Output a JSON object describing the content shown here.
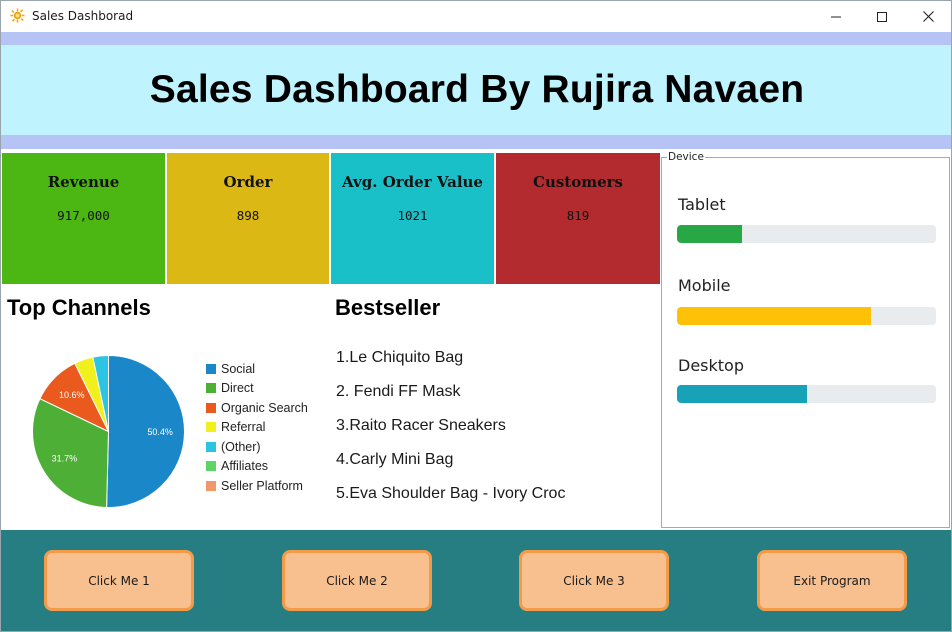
{
  "window": {
    "title": "Sales Dashborad"
  },
  "header": {
    "title": "Sales Dashboard By Rujira Navaen"
  },
  "kpis": [
    {
      "label": "Revenue",
      "value": "917,000",
      "color": "#4cb612"
    },
    {
      "label": "Order",
      "value": "898",
      "color": "#dbb814"
    },
    {
      "label": "Avg. Order Value",
      "value": "1021",
      "color": "#1ac0c8"
    },
    {
      "label": "Customers",
      "value": "819",
      "color": "#b32b2f"
    }
  ],
  "top_channels": {
    "title": "Top Channels"
  },
  "bestseller": {
    "title": "Bestseller",
    "items": [
      "1.Le Chiquito Bag",
      "2. Fendi FF Mask",
      "3.Raito Racer Sneakers",
      "4.Carly Mini Bag",
      "5.Eva Shoulder Bag - Ivory Croc"
    ]
  },
  "device": {
    "legend": "Device",
    "items": [
      {
        "label": "Tablet",
        "fraction": 0.25,
        "color": "#28a745"
      },
      {
        "label": "Mobile",
        "fraction": 0.75,
        "color": "#ffc107"
      },
      {
        "label": "Desktop",
        "fraction": 0.5,
        "color": "#17a2b8"
      }
    ]
  },
  "footer": {
    "buttons": [
      "Click Me 1",
      "Click Me 2",
      "Click Me 3",
      "Exit Program"
    ]
  },
  "chart_data": {
    "type": "pie",
    "title": "",
    "legend_position": "right",
    "categories": [
      "Social",
      "Direct",
      "Organic Search",
      "Referral",
      "(Other)",
      "Affiliates",
      "Seller Platform"
    ],
    "values": [
      50.4,
      31.7,
      10.6,
      4.0,
      3.3,
      0,
      0
    ],
    "data_labels": [
      "50.4%",
      "31.7%",
      "10.6%",
      "",
      "",
      "",
      ""
    ],
    "colors": [
      "#1a87c9",
      "#4daf35",
      "#ea5a1f",
      "#f1ef1c",
      "#2bc4e2",
      "#5dd465",
      "#f0986a"
    ]
  }
}
